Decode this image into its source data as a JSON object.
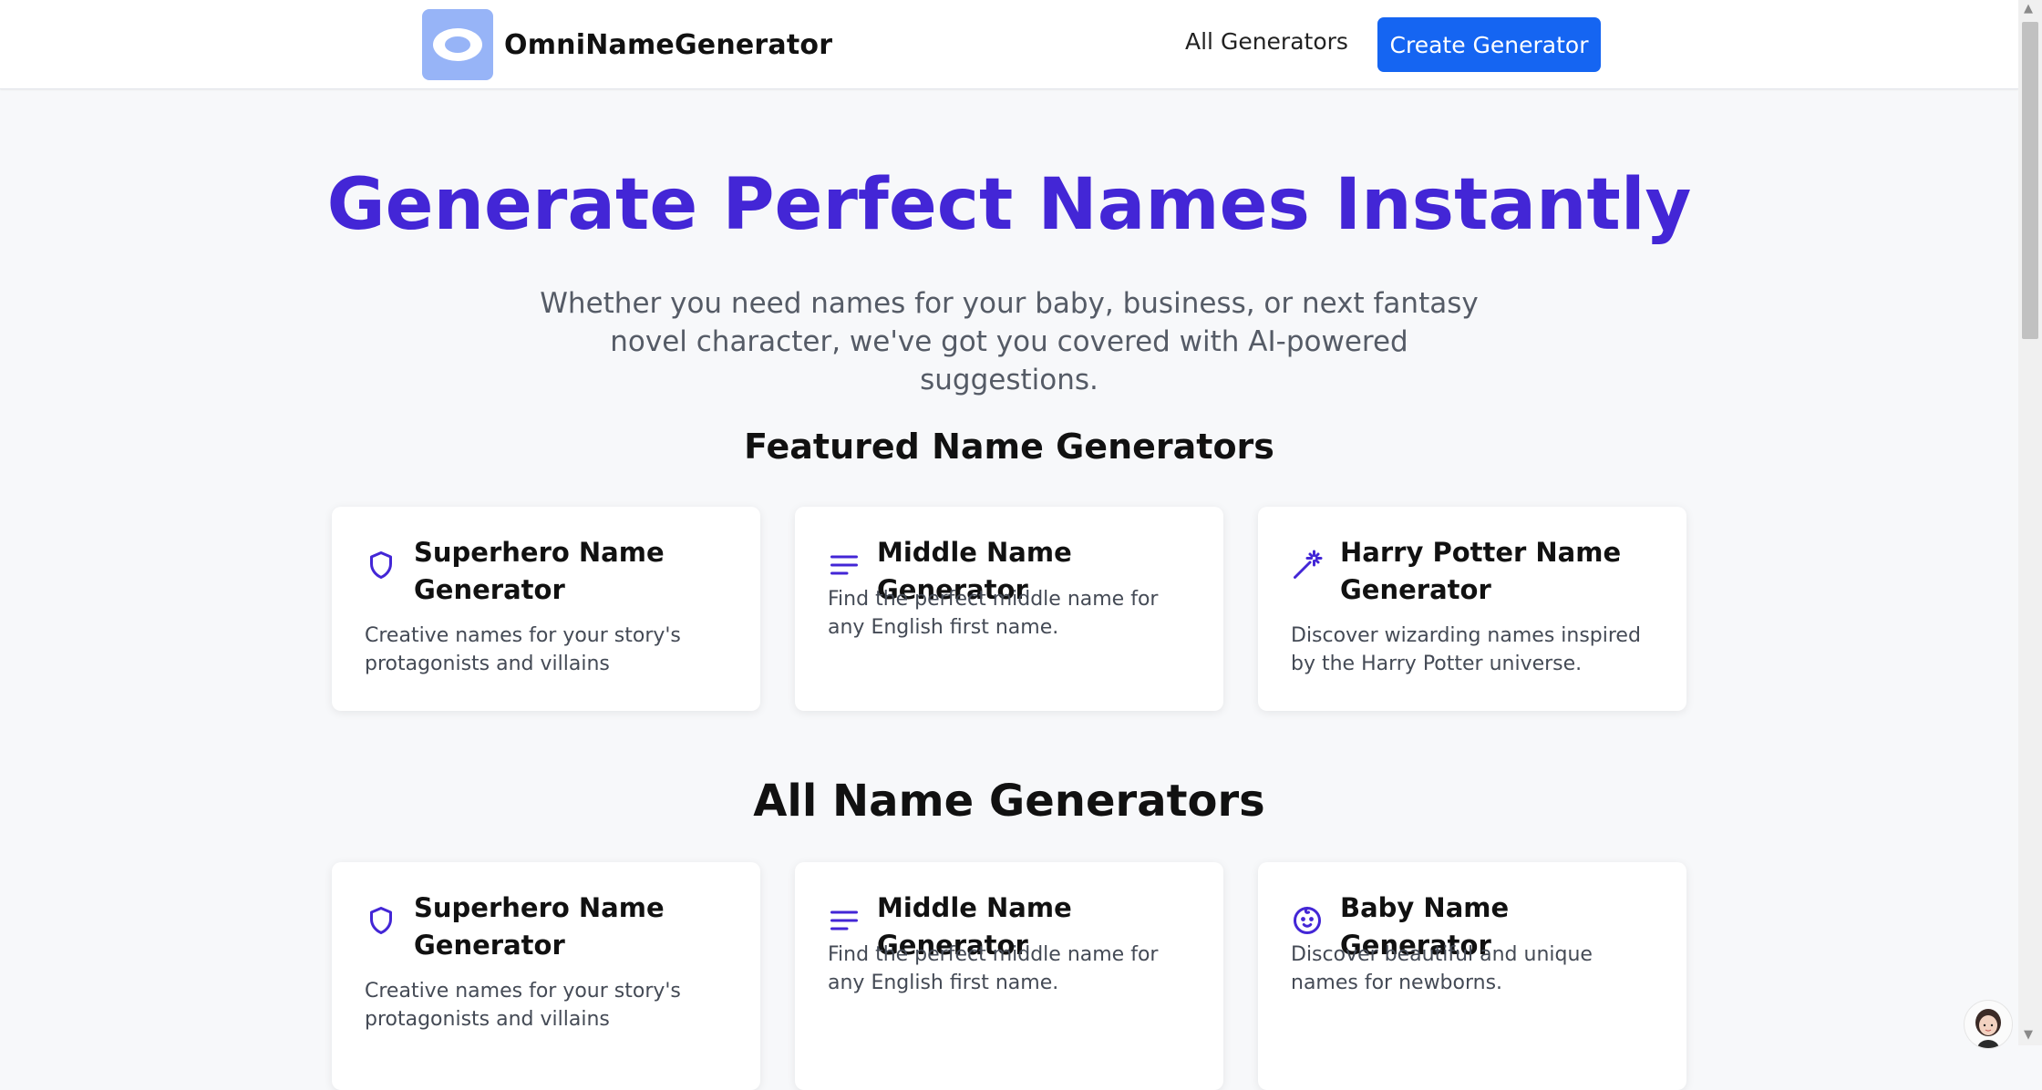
{
  "navbar": {
    "brand_name": "OmniNameGenerator",
    "nav_link": "All Generators",
    "cta_label": "Create Generator"
  },
  "hero": {
    "title": "Generate Perfect Names Instantly",
    "subtitle_line1": "Whether you need names for your baby, business, or next fantasy",
    "subtitle_line2": "novel character, we've got you covered with AI-powered suggestions."
  },
  "featured": {
    "heading": "Featured Name Generators",
    "cards": [
      {
        "title": "Superhero Name Generator",
        "description": "Creative names for your story's protagonists and villains",
        "icon": "shield-icon"
      },
      {
        "title": "Middle Name Generator",
        "description": "Find the perfect middle name for any English first name.",
        "icon": "lines-icon"
      },
      {
        "title": "Harry Potter Name Generator",
        "description": "Discover wizarding names inspired by the Harry Potter universe.",
        "icon": "magic-wand-icon"
      }
    ]
  },
  "all": {
    "heading": "All Name Generators",
    "cards": [
      {
        "title": "Superhero Name Generator",
        "description": "Creative names for your story's protagonists and villains",
        "icon": "shield-icon"
      },
      {
        "title": "Middle Name Generator",
        "description": "Find the perfect middle name for any English first name.",
        "icon": "lines-icon"
      },
      {
        "title": "Baby Name Generator",
        "description": "Discover beautiful and unique names for newborns.",
        "icon": "baby-face-icon"
      }
    ]
  },
  "colors": {
    "accent": "#4326d6",
    "primary_button": "#1565f2",
    "logo_bg": "#97b4f7"
  }
}
